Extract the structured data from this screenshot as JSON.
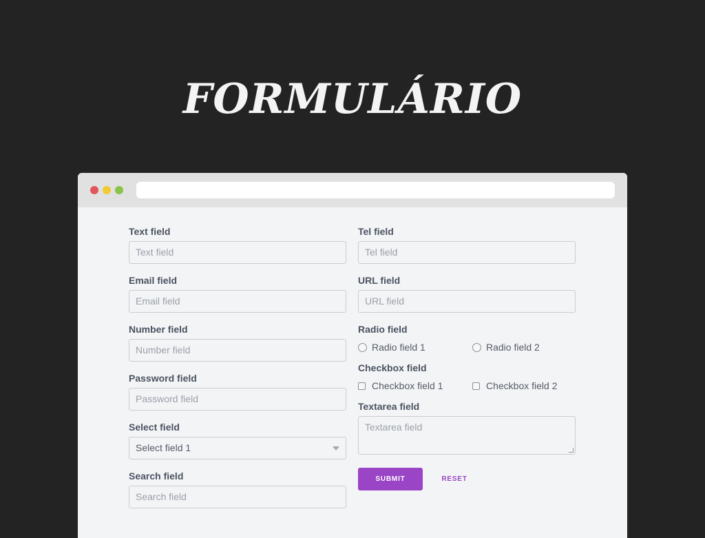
{
  "title": "FORMULÁRIO",
  "window": {
    "traffic_lights": [
      "#e0575a",
      "#f0cb32",
      "#88c44a"
    ],
    "address_bar": ""
  },
  "form": {
    "text": {
      "label": "Text field",
      "placeholder": "Text field"
    },
    "email": {
      "label": "Email field",
      "placeholder": "Email field"
    },
    "number": {
      "label": "Number field",
      "placeholder": "Number field"
    },
    "password": {
      "label": "Password field",
      "placeholder": "Password field"
    },
    "select": {
      "label": "Select field",
      "value": "Select field 1"
    },
    "search": {
      "label": "Search field",
      "placeholder": "Search field"
    },
    "tel": {
      "label": "Tel field",
      "placeholder": "Tel field"
    },
    "url": {
      "label": "URL field",
      "placeholder": "URL field"
    },
    "radio": {
      "label": "Radio field",
      "options": [
        "Radio field 1",
        "Radio field 2"
      ]
    },
    "checkbox": {
      "label": "Checkbox field",
      "options": [
        "Checkbox field 1",
        "Checkbox field 2"
      ]
    },
    "textarea": {
      "label": "Textarea field",
      "placeholder": "Textarea field"
    },
    "submit_label": "SUBMIT",
    "reset_label": "RESET"
  },
  "colors": {
    "background": "#232323",
    "accent": "#9a44c6"
  }
}
